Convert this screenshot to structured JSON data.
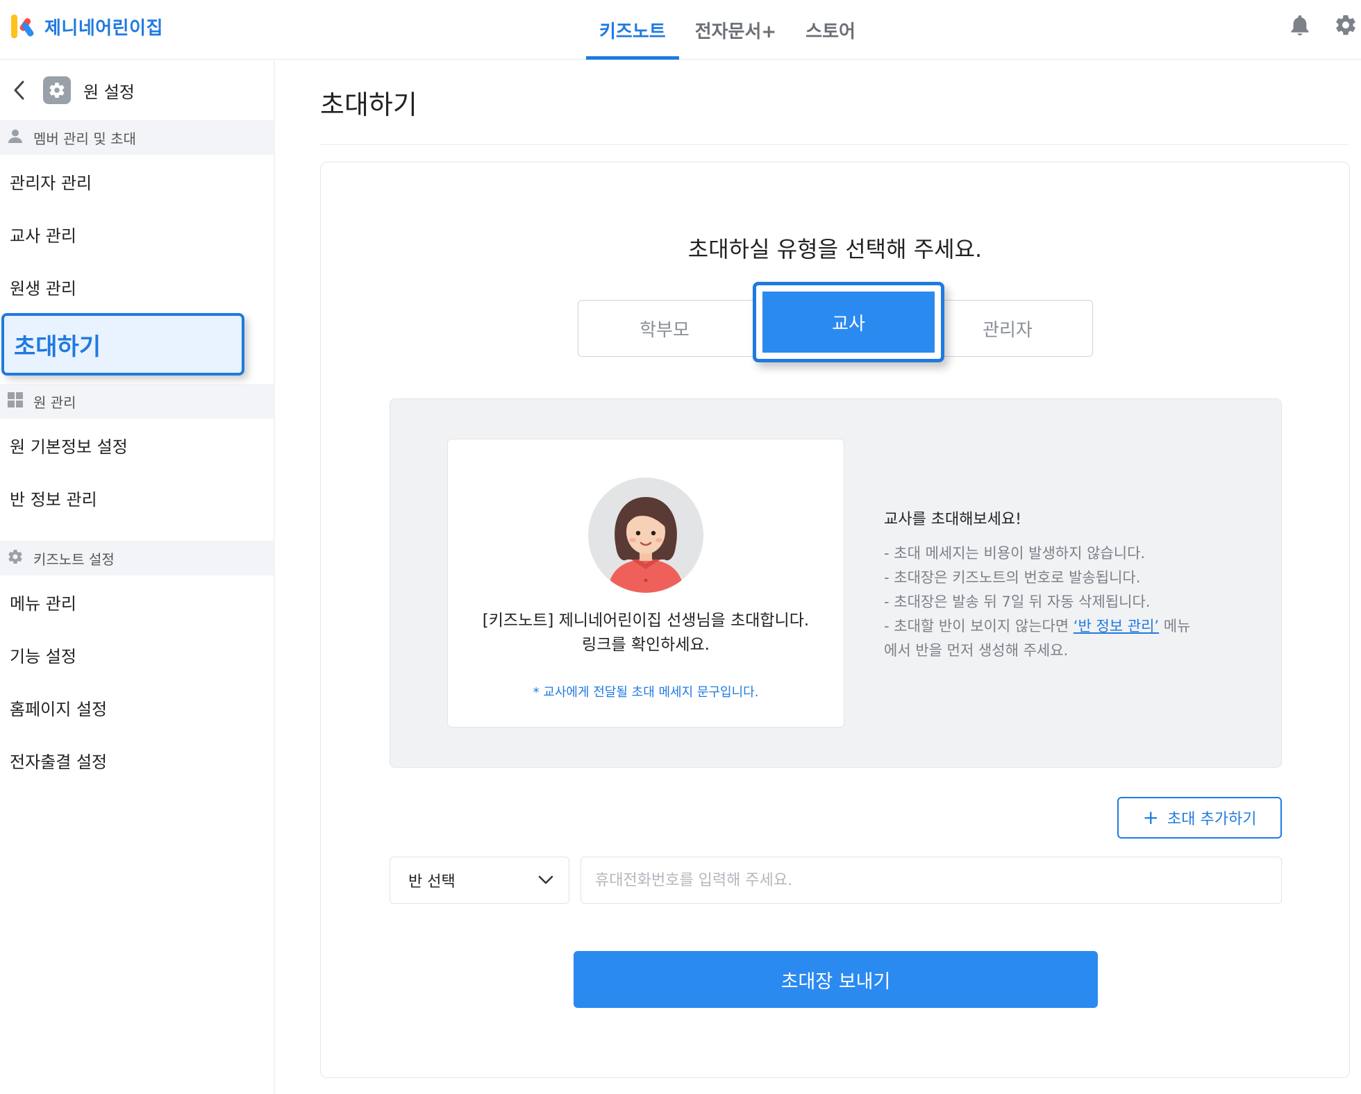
{
  "brand": {
    "name": "제니네어린이집"
  },
  "topnav": {
    "items": [
      {
        "label": "키즈노트",
        "active": true
      },
      {
        "label": "전자문서+",
        "active": false
      },
      {
        "label": "스토어",
        "active": false
      }
    ]
  },
  "sidebar": {
    "title": "원 설정",
    "sections": [
      {
        "label": "멤버 관리 및 초대",
        "icon": "person-icon",
        "items": [
          {
            "label": "관리자 관리"
          },
          {
            "label": "교사 관리"
          },
          {
            "label": "원생 관리"
          },
          {
            "label": "초대하기",
            "active": true
          }
        ]
      },
      {
        "label": "원 관리",
        "icon": "grid-icon",
        "items": [
          {
            "label": "원 기본정보 설정"
          },
          {
            "label": "반 정보 관리"
          }
        ]
      },
      {
        "label": "키즈노트 설정",
        "icon": "gear-icon",
        "items": [
          {
            "label": "메뉴 관리"
          },
          {
            "label": "기능 설정"
          },
          {
            "label": "홈페이지 설정"
          },
          {
            "label": "전자출결 설정"
          }
        ]
      }
    ]
  },
  "main": {
    "title": "초대하기",
    "prompt": "초대하실 유형을 선택해 주세요.",
    "types": [
      {
        "label": "학부모",
        "selected": false
      },
      {
        "label": "교사",
        "selected": true
      },
      {
        "label": "관리자",
        "selected": false
      }
    ],
    "message_card": {
      "line1": "[키즈노트] 제니네어린이집 선생님을 초대합니다.",
      "line2": "링크를 확인하세요.",
      "note": "* 교사에게 전달될 초대 메세지 문구입니다."
    },
    "guide": {
      "title": "교사를 초대해보세요!",
      "line1": "- 초대 메세지는 비용이 발생하지 않습니다.",
      "line2": "- 초대장은 키즈노트의 번호로 발송됩니다.",
      "line3": "- 초대장은 발송 뒤 7일 뒤 자동 삭제됩니다.",
      "line4_prefix": "- 초대할 반이 보이지 않는다면 ",
      "line4_link": "‘반 정보 관리’",
      "line4_suffix": " 메뉴",
      "line5": "에서 반을 먼저 생성해 주세요."
    },
    "add_invite_label": "초대 추가하기",
    "class_select": {
      "value": "반 선택"
    },
    "phone_input": {
      "value": "",
      "placeholder": "휴대전화번호를 입력해 주세요."
    },
    "send_label": "초대장 보내기"
  },
  "colors": {
    "accent": "#1f7ae0",
    "button": "#2b8af0",
    "panel": "#f1f2f4",
    "section_bg": "#f2f4f7"
  }
}
